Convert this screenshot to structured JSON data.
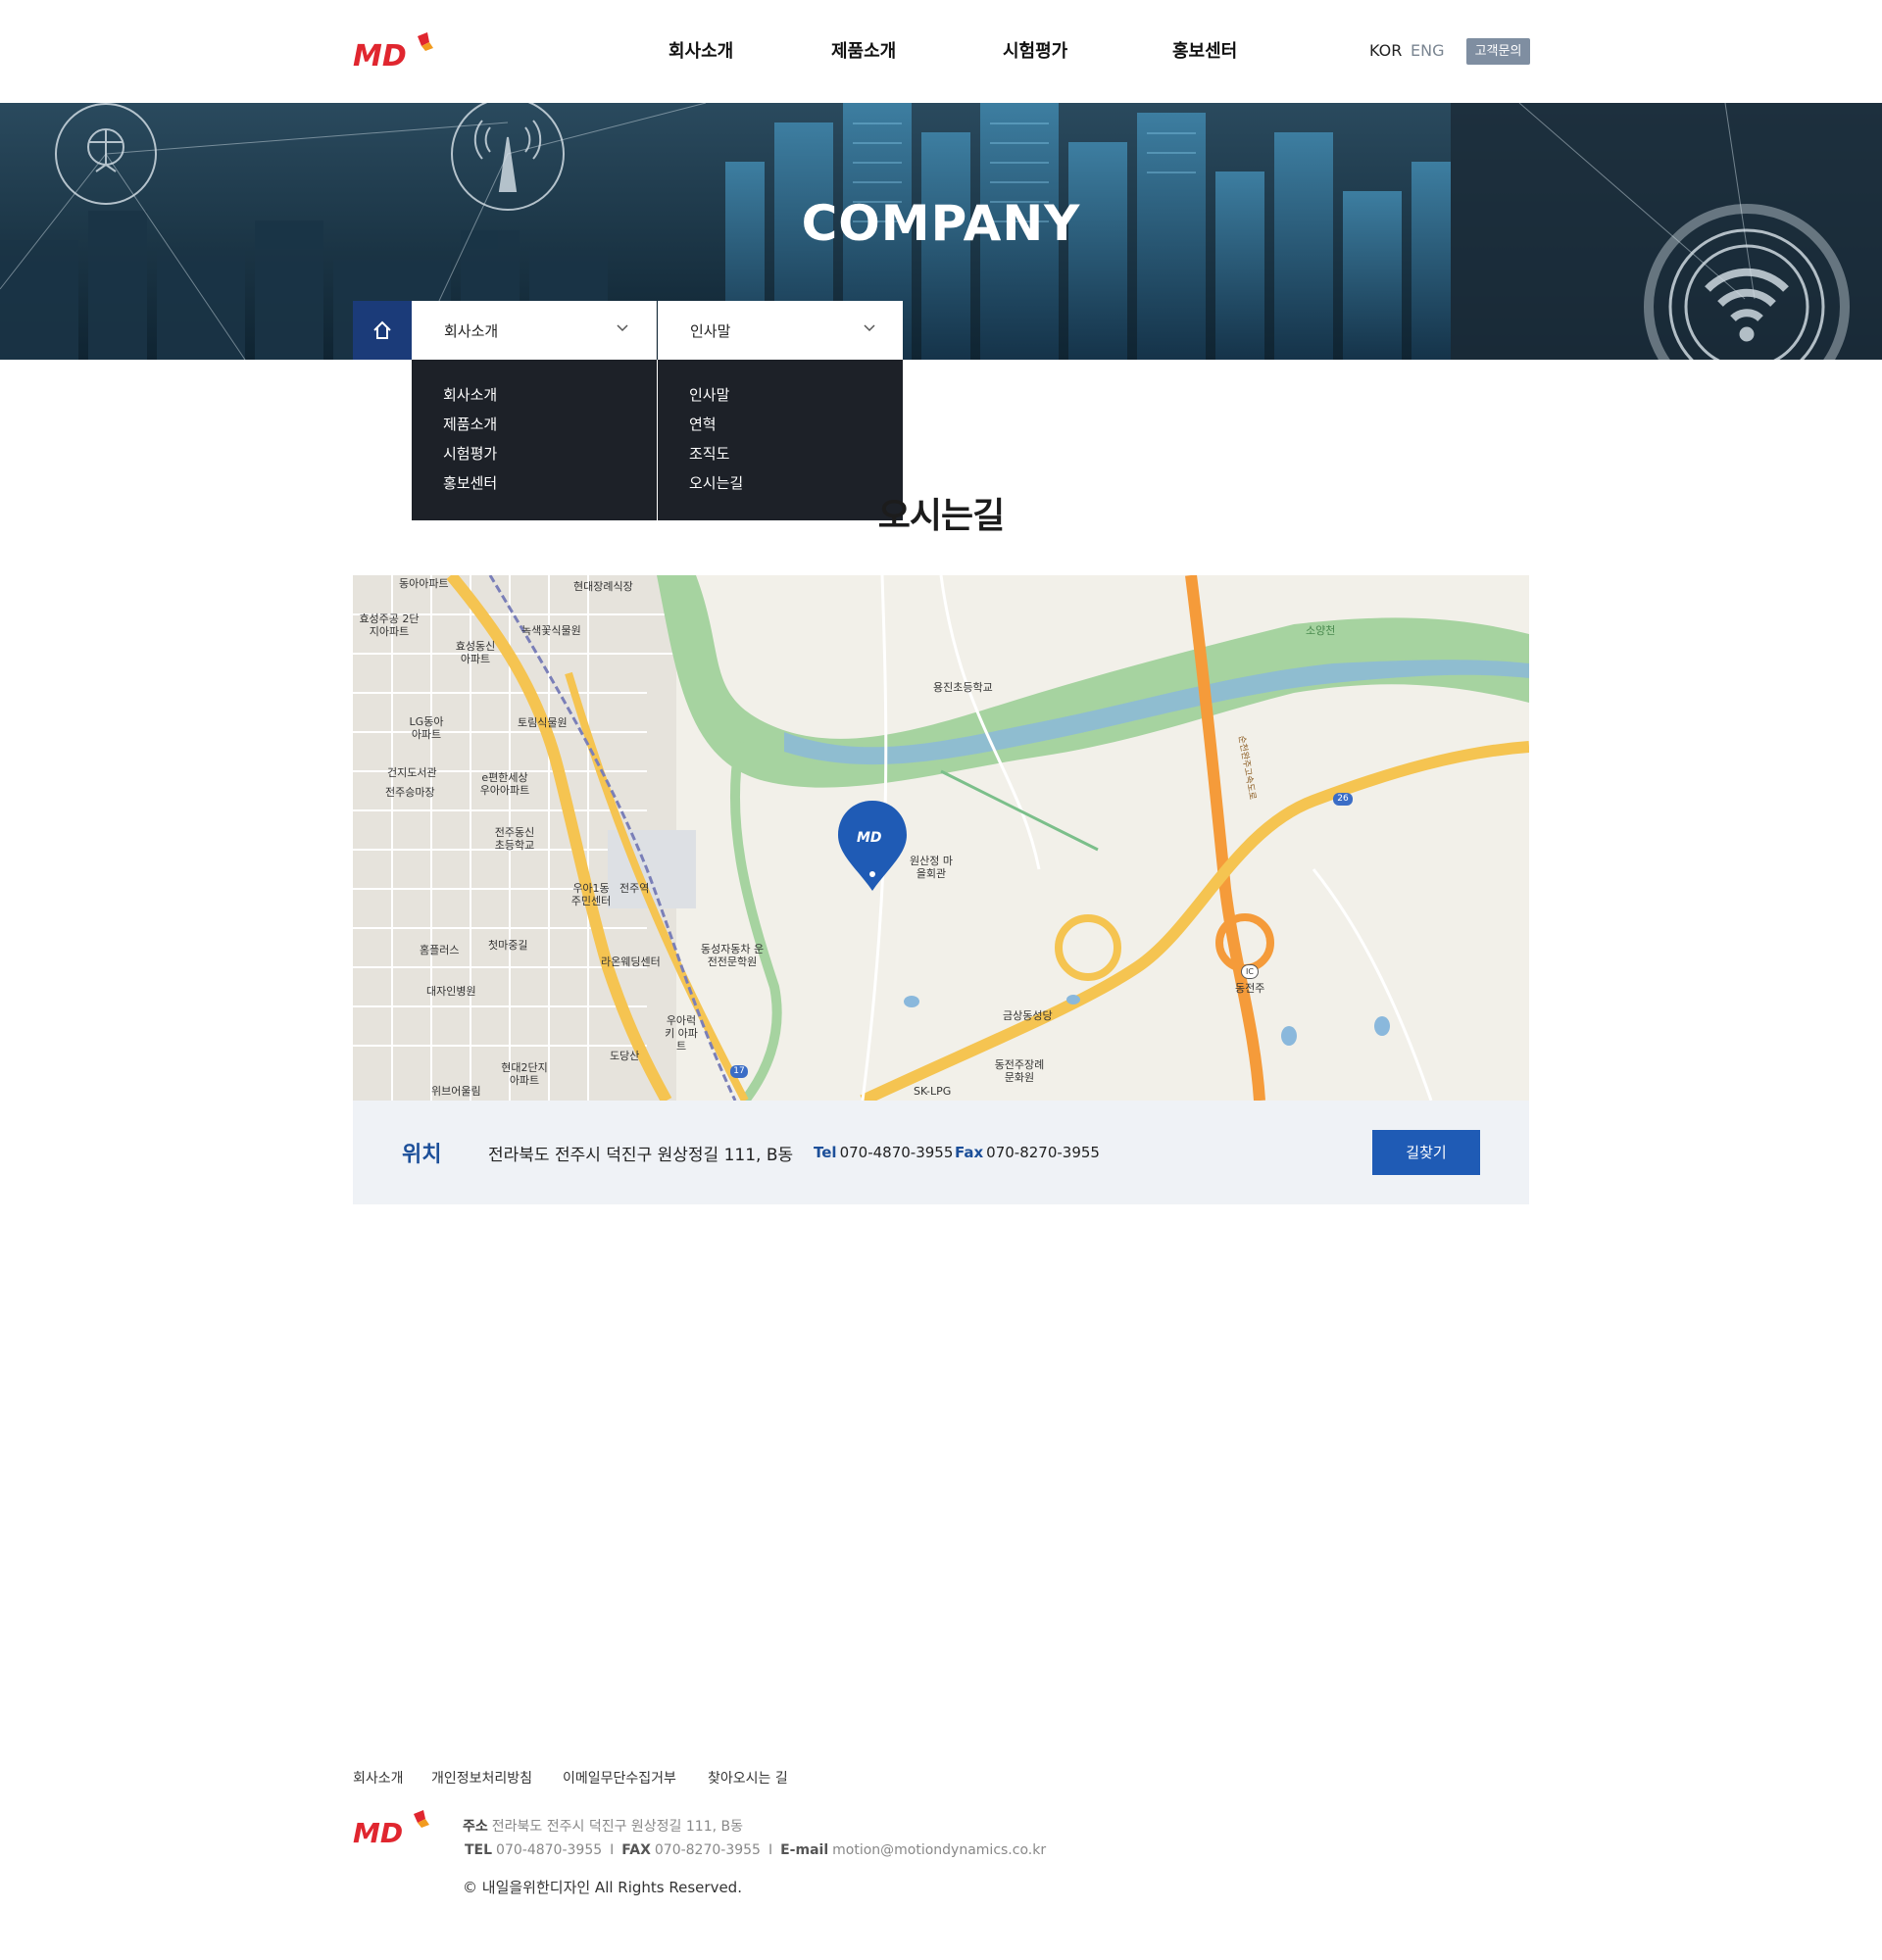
{
  "header": {
    "nav": [
      "회사소개",
      "제품소개",
      "시험평가",
      "홍보센터"
    ],
    "lang_kor": "KOR",
    "lang_eng": "ENG",
    "contact_label": "고객문의"
  },
  "hero": {
    "title": "COMPANY"
  },
  "subnav": {
    "dropdown1": {
      "selected": "회사소개",
      "items": [
        "회사소개",
        "제품소개",
        "시험평가",
        "홍보센터"
      ]
    },
    "dropdown2": {
      "selected": "인사말",
      "items": [
        "인사말",
        "연혁",
        "조직도",
        "오시는길"
      ]
    }
  },
  "page_title": "오시는길",
  "map": {
    "labels": [
      "동아아파트",
      "현대장례식장",
      "효성주공 2단지아파트",
      "녹색꽃식물원",
      "효성동신 아파트",
      "용진초등학교",
      "소양천",
      "LG동아 아파트",
      "토림식물원",
      "건지도서관",
      "전주승마장",
      "e편한세상 우아아파트",
      "전주동신 초등학교",
      "원산정 마을회관",
      "우아1동 주민센터",
      "전주역",
      "홈플러스",
      "첫마중길",
      "라온웨딩센터",
      "동성자동차 운전전문학원",
      "대자인병원",
      "금상동성당",
      "동전주",
      "우아럭키 아파트",
      "도당산",
      "현대2단지 아파트",
      "동전주장례 문화원",
      "SK-LPG",
      "위브어울림",
      "순천완주고속도로",
      "26",
      "17",
      "IC"
    ]
  },
  "location": {
    "label": "위치",
    "address": "전라북도 전주시 덕진구 원상정길 111, B동",
    "tel_label": "Tel",
    "tel": "070-4870-3955",
    "fax_label": "Fax",
    "fax": "070-8270-3955",
    "route_button": "길찾기"
  },
  "footer": {
    "links": [
      "회사소개",
      "개인정보처리방침",
      "이메일무단수집거부",
      "찾아오시는 길"
    ],
    "addr_label": "주소",
    "address": "전라북도 전주시 덕진구 원상정길 111, B동",
    "tel_label": "TEL",
    "tel": "070-4870-3955",
    "fax_label": "FAX",
    "fax": "070-8270-3955",
    "email_label": "E-mail",
    "email": "motion@motiondynamics.co.kr",
    "copyright": "© 내일을위한디자인  All Rights Reserved."
  },
  "colors": {
    "brand_red": "#e0262f",
    "accent_blue": "#1f5bb5",
    "dark_navy": "#1b3b79",
    "dropdown_bg": "#1d2128"
  }
}
